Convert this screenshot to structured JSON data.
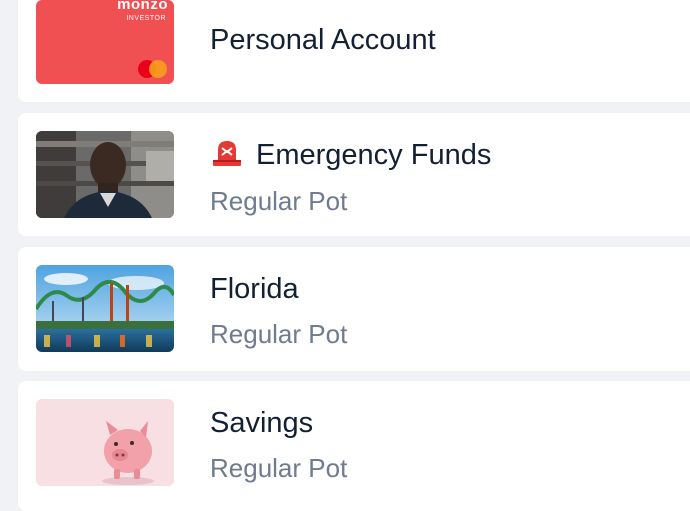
{
  "accounts": [
    {
      "title": "Personal Account",
      "card_brand": "monzo",
      "card_tier": "INVESTOR",
      "card_color": "#f15053",
      "network_icon": "mastercard-icon"
    },
    {
      "title": "Emergency Funds",
      "emoji_icon": "police-light-icon",
      "subtitle": "Regular Pot"
    },
    {
      "title": "Florida",
      "subtitle": "Regular Pot"
    },
    {
      "title": "Savings",
      "subtitle": "Regular Pot"
    }
  ]
}
